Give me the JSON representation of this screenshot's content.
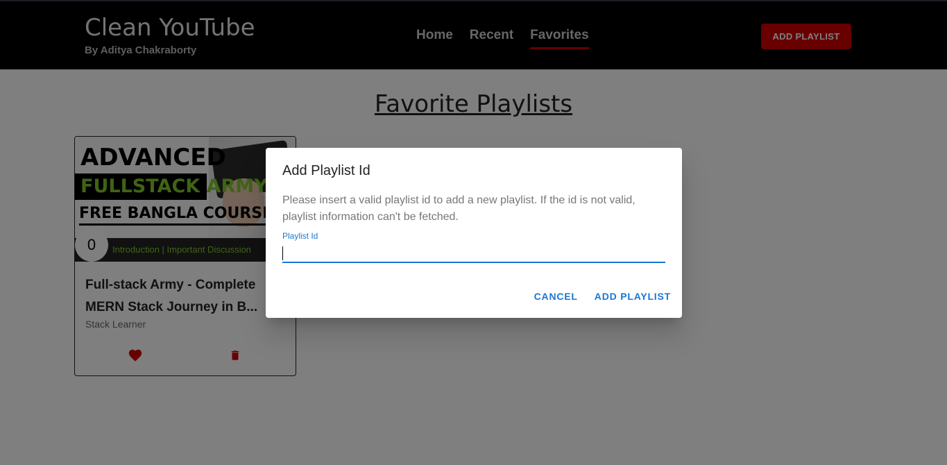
{
  "app": {
    "title": "Clean YouTube",
    "subtitle": "By Aditya Chakraborty",
    "add_playlist_label": "ADD PLAYLIST",
    "accent_color": "#d10000"
  },
  "nav": {
    "items": [
      {
        "label": "Home"
      },
      {
        "label": "Recent"
      },
      {
        "label": "Favorites",
        "active": true
      }
    ]
  },
  "page": {
    "title": "Favorite Playlists"
  },
  "playlist_card": {
    "thumb_line1": "ADVANCED",
    "thumb_line2": "FULLSTACK ARMY",
    "thumb_line3": "FREE BANGLA COURSE",
    "thumb_caption": "Introduction | Important Discussion",
    "count": "0",
    "title": "Full-stack Army - Complete MERN Stack Journey in B...",
    "channel": "Stack Learner",
    "icons": [
      "heart-icon",
      "trash-icon"
    ]
  },
  "dialog": {
    "title": "Add Playlist Id",
    "text": "Please insert a valid playlist id to add a new playlist. If the id is not valid, playlist information can't be fetched.",
    "field_label": "Playlist Id",
    "field_value": "",
    "cancel_label": "CANCEL",
    "submit_label": "ADD PLAYLIST"
  }
}
